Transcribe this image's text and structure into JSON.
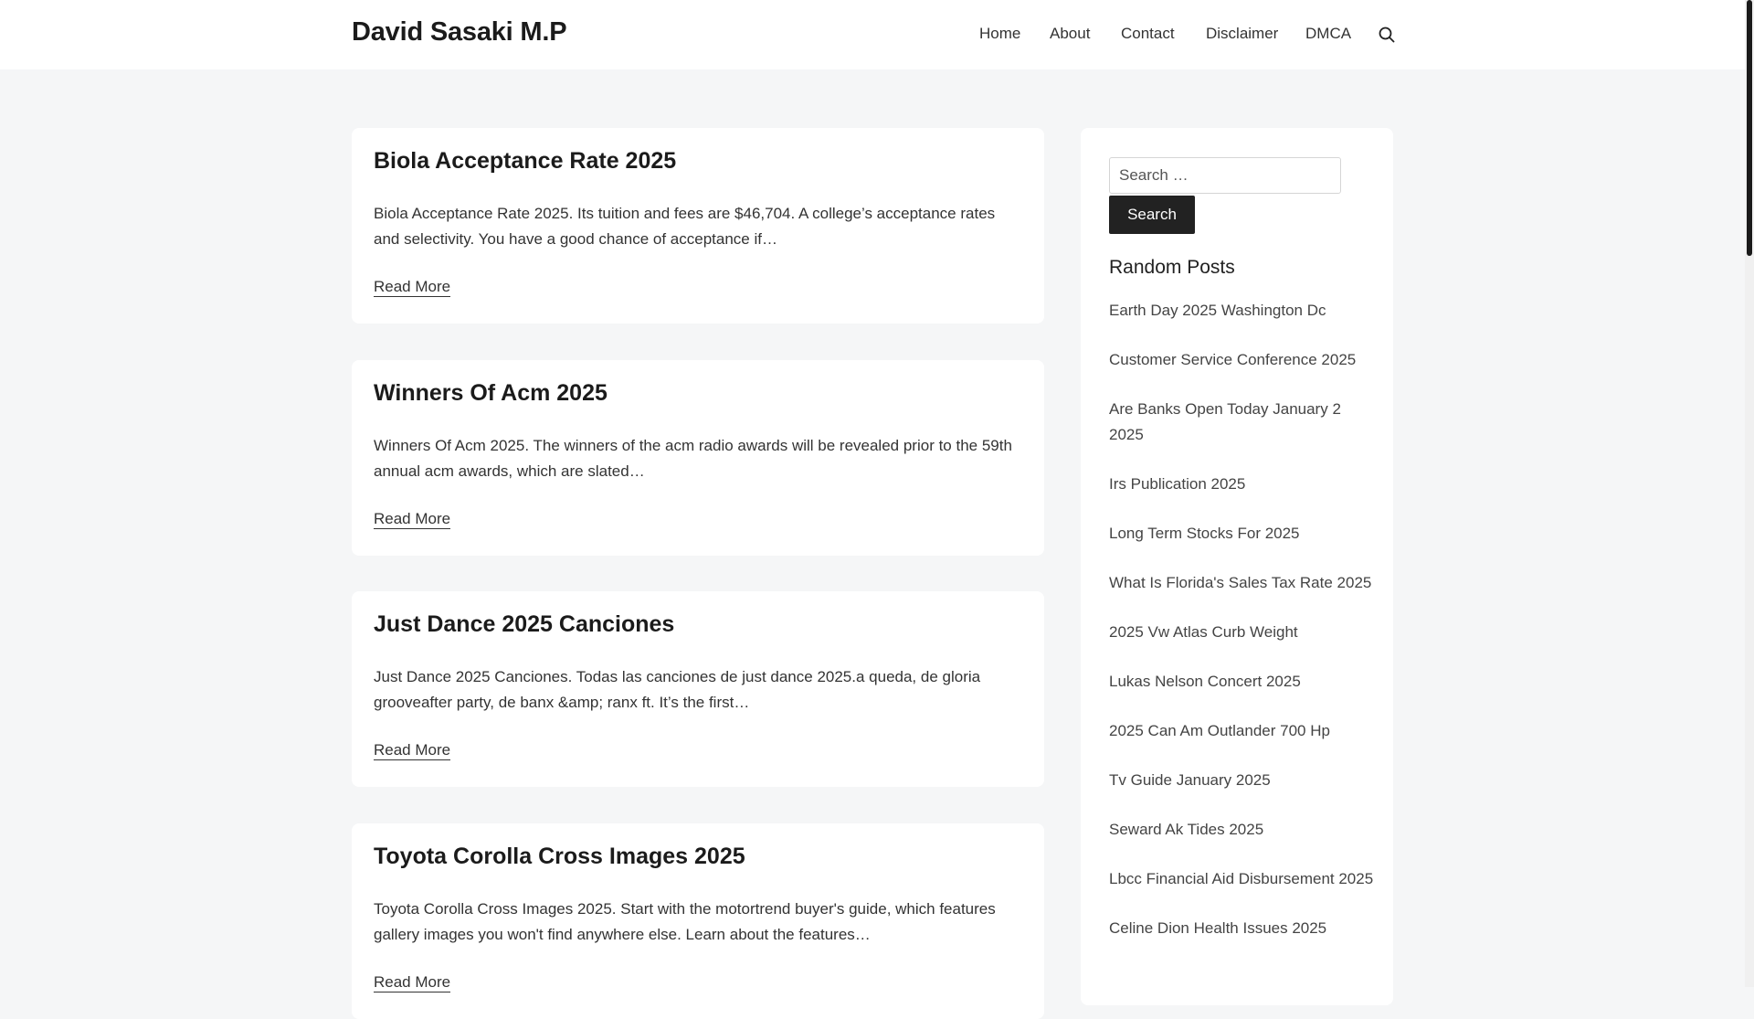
{
  "header": {
    "site_title": "David Sasaki M.P",
    "nav": [
      "Home",
      "About",
      "Contact",
      "Disclaimer",
      "DMCA"
    ],
    "search_icon": "search-icon"
  },
  "posts": [
    {
      "title": "Biola Acceptance Rate 2025",
      "excerpt": "Biola Acceptance Rate 2025. Its tuition and fees are $46,704. A college’s acceptance rates and selectivity. You have a good chance of acceptance if…",
      "read_more": "Read More"
    },
    {
      "title": "Winners Of Acm 2025",
      "excerpt": "Winners Of Acm 2025. The winners of the acm radio awards will be revealed prior to the 59th annual acm awards, which are slated…",
      "read_more": "Read More"
    },
    {
      "title": "Just Dance 2025 Canciones",
      "excerpt": "Just Dance 2025 Canciones. Todas las canciones de just dance 2025.a queda, de gloria grooveafter party, de banx &amp; ranx ft. It’s the first…",
      "read_more": "Read More"
    },
    {
      "title": "Toyota Corolla Cross Images 2025",
      "excerpt": "Toyota Corolla Cross Images 2025. Start with the motortrend buyer's guide, which features gallery images you won't find anywhere else. Learn about the features…",
      "read_more": "Read More"
    }
  ],
  "sidebar": {
    "search_placeholder": "Search …",
    "search_button": "Search",
    "random_posts_title": "Random Posts",
    "random_posts": [
      "Earth Day 2025 Washington Dc",
      "Customer Service Conference 2025",
      "Are Banks Open Today January 2 2025",
      "Irs Publication 2025",
      "Long Term Stocks For 2025",
      "What Is Florida's Sales Tax Rate 2025",
      "2025 Vw Atlas Curb Weight",
      "Lukas Nelson Concert 2025",
      "2025 Can Am Outlander 700 Hp",
      "Tv Guide January 2025",
      "Seward Ak Tides 2025",
      "Lbcc Financial Aid Disbursement 2025",
      "Celine Dion Health Issues 2025"
    ]
  }
}
